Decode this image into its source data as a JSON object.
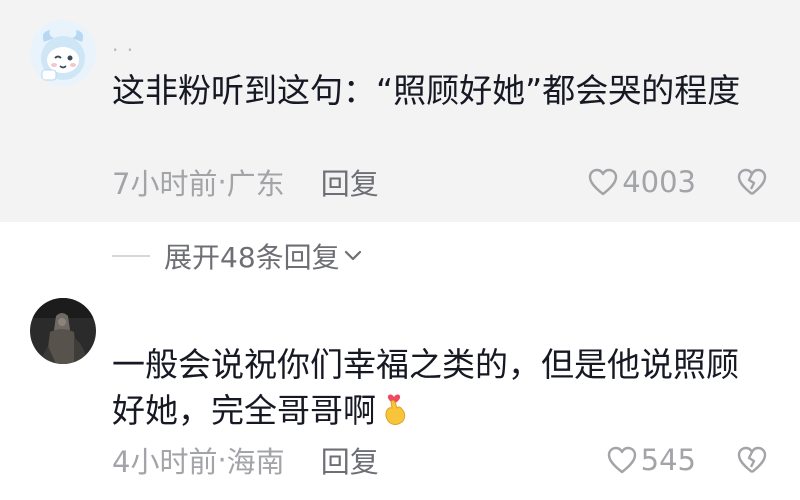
{
  "comments": [
    {
      "username": "· ·",
      "text": "这非粉听到这句：“照顾好她”都会哭的程度",
      "time": "7小时前",
      "location": "广东",
      "reply_label": "回复",
      "likes": "4003"
    },
    {
      "text": "一般会说祝你们幸福之类的，但是他说照顾好她，完全哥哥啊",
      "time": "4小时前",
      "location": "海南",
      "reply_label": "回复",
      "likes": "545"
    }
  ],
  "expand": {
    "label": "展开48条回复"
  },
  "meta_separator": "·",
  "icons": {
    "like": "heart-outline-icon",
    "dislike": "broken-heart-icon",
    "expand": "chevron-down-icon",
    "emoji": "finger-heart-emoji"
  },
  "colors": {
    "highlight_bg": "#f3f3f4",
    "text_primary": "#161823",
    "text_secondary": "#a3a4a8",
    "reply_text": "#6e6f75"
  }
}
